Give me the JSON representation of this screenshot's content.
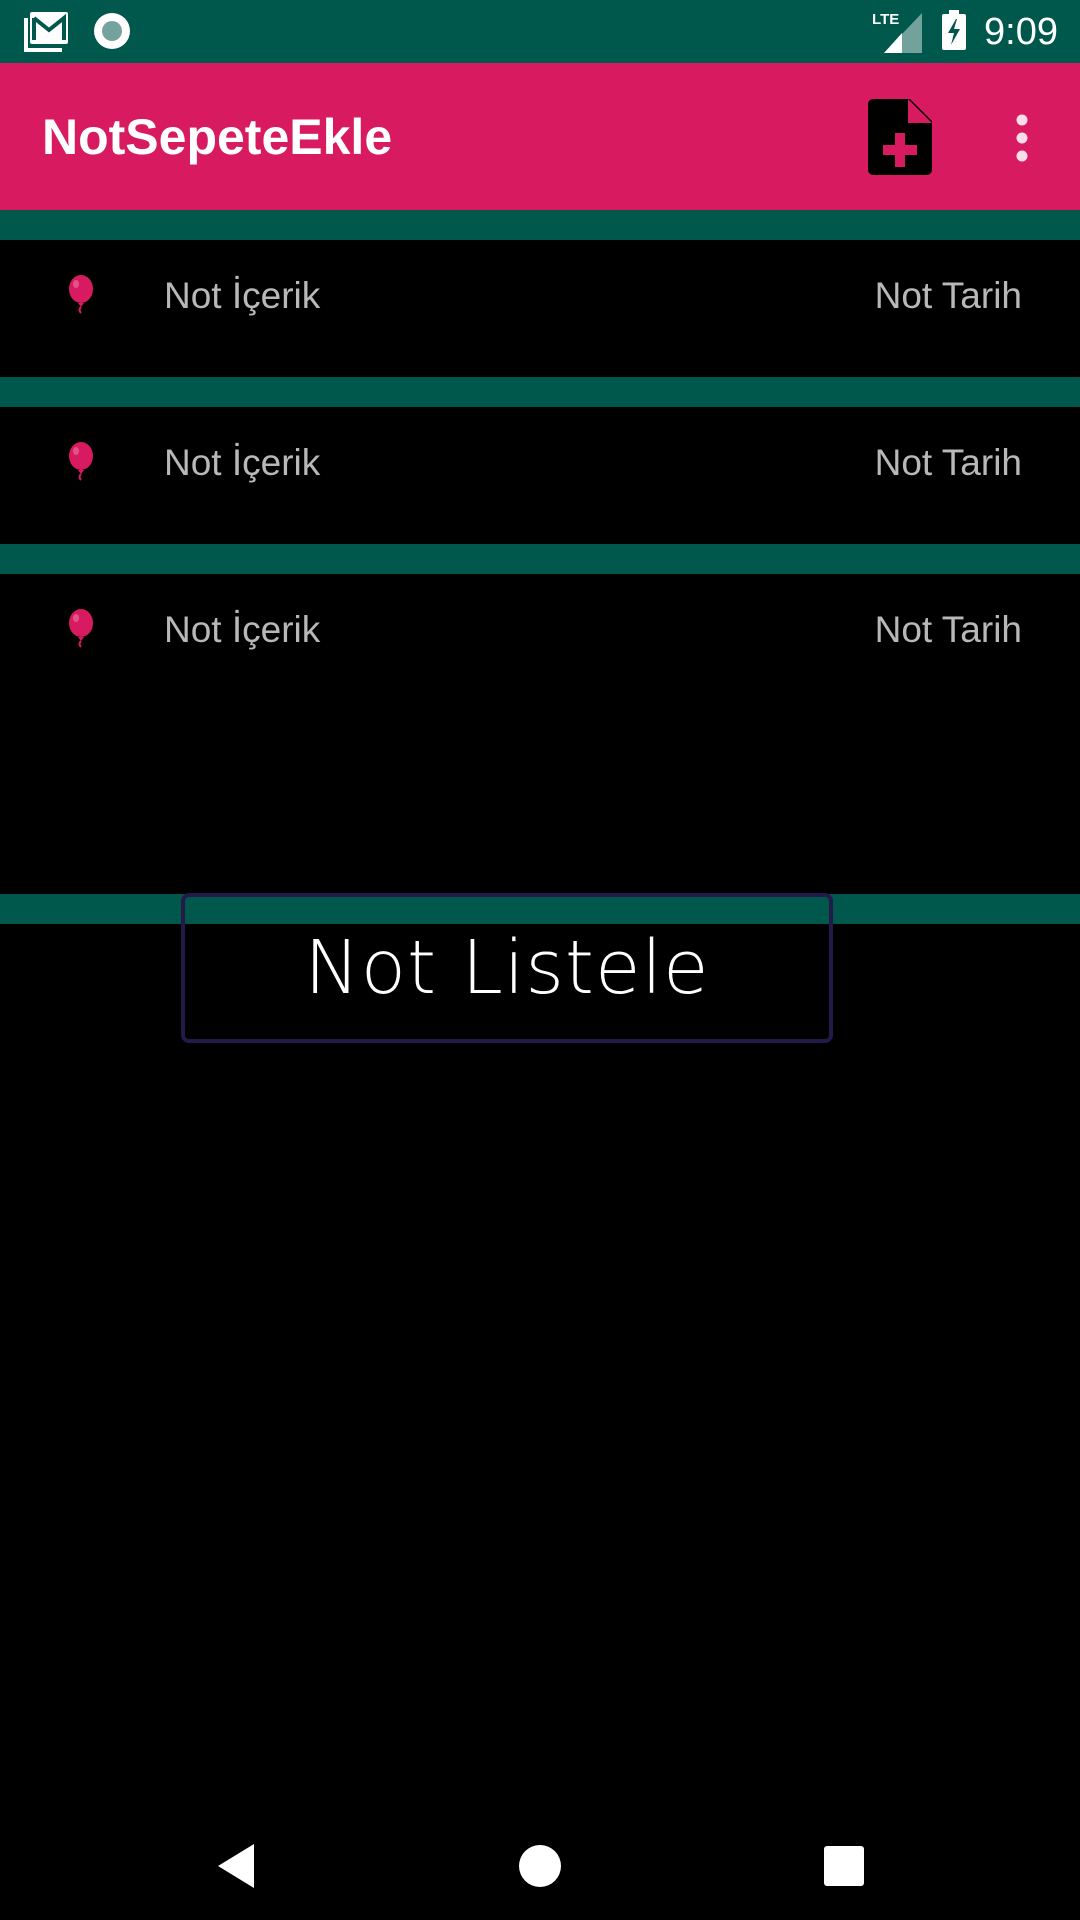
{
  "status_bar": {
    "time": "9:09",
    "network": "LTE",
    "icons": [
      "gmail-icon",
      "notification-circle-icon",
      "signal-icon",
      "battery-charging-icon"
    ]
  },
  "app_bar": {
    "title": "NotSepeteEkle",
    "actions": [
      "add-note-icon",
      "more-vert-icon"
    ]
  },
  "notes": [
    {
      "content": "Not İçerik",
      "date": "Not Tarih",
      "icon": "balloon-icon"
    },
    {
      "content": "Not İçerik",
      "date": "Not Tarih",
      "icon": "balloon-icon"
    },
    {
      "content": "Not İçerik",
      "date": "Not Tarih",
      "icon": "balloon-icon"
    }
  ],
  "list_button": {
    "label": "Not Listele"
  },
  "nav_bar": {
    "buttons": [
      "back-icon",
      "home-icon",
      "recents-icon"
    ]
  },
  "colors": {
    "primary": "#d81b60",
    "primary_dark": "#00574b",
    "background": "#000000",
    "text_secondary": "#b8b8b8"
  }
}
